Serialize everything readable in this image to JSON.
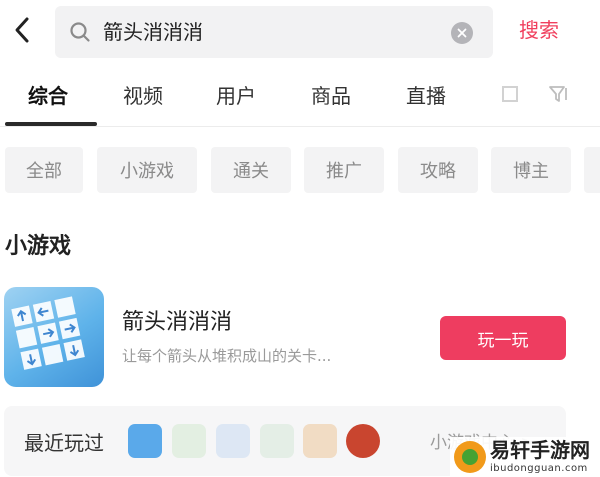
{
  "header": {
    "search_query": "箭头消消消",
    "search_button": "搜索"
  },
  "tabs": [
    {
      "label": "综合",
      "active": true
    },
    {
      "label": "视频"
    },
    {
      "label": "用户"
    },
    {
      "label": "商品"
    },
    {
      "label": "直播"
    }
  ],
  "chips": [
    "全部",
    "小游戏",
    "通关",
    "推广",
    "攻略",
    "博主"
  ],
  "section": {
    "title": "小游戏"
  },
  "game": {
    "name": "箭头消消消",
    "description": "让每个箭头从堆积成山的关卡...",
    "play_button": "玩一玩"
  },
  "recent": {
    "label": "最近玩过",
    "more": "小游戏中心 >"
  },
  "watermark": {
    "title": "易轩手游网",
    "subtitle": "ibudongguan.com"
  },
  "colors": {
    "accent": "#ee3d60",
    "search_text": "#f0405e",
    "chip_bg": "#f3f3f4"
  }
}
